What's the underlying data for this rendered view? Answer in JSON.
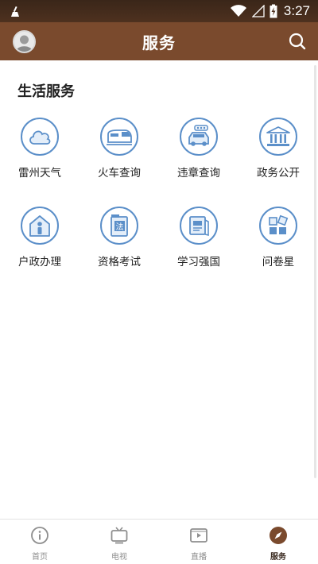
{
  "status_bar": {
    "time": "3:27"
  },
  "header": {
    "title": "服务"
  },
  "section": {
    "title": "生活服务"
  },
  "services": [
    {
      "label": "雷州天气",
      "icon": "cloud-icon"
    },
    {
      "label": "火车查询",
      "icon": "train-icon"
    },
    {
      "label": "违章查询",
      "icon": "car-icon"
    },
    {
      "label": "政务公开",
      "icon": "government-building-icon"
    },
    {
      "label": "户政办理",
      "icon": "house-person-icon"
    },
    {
      "label": "资格考试",
      "icon": "law-book-icon"
    },
    {
      "label": "学习强国",
      "icon": "study-book-icon"
    },
    {
      "label": "问卷星",
      "icon": "grid-blocks-icon"
    }
  ],
  "bottom_nav": [
    {
      "label": "首页",
      "icon": "info-circle-icon"
    },
    {
      "label": "电视",
      "icon": "tv-icon"
    },
    {
      "label": "直播",
      "icon": "live-video-icon"
    },
    {
      "label": "服务",
      "icon": "compass-icon",
      "active": true
    }
  ],
  "colors": {
    "header": "#7a4a2d",
    "accent_blue": "#5b8fc9",
    "nav_active": "#7a4a2d"
  }
}
